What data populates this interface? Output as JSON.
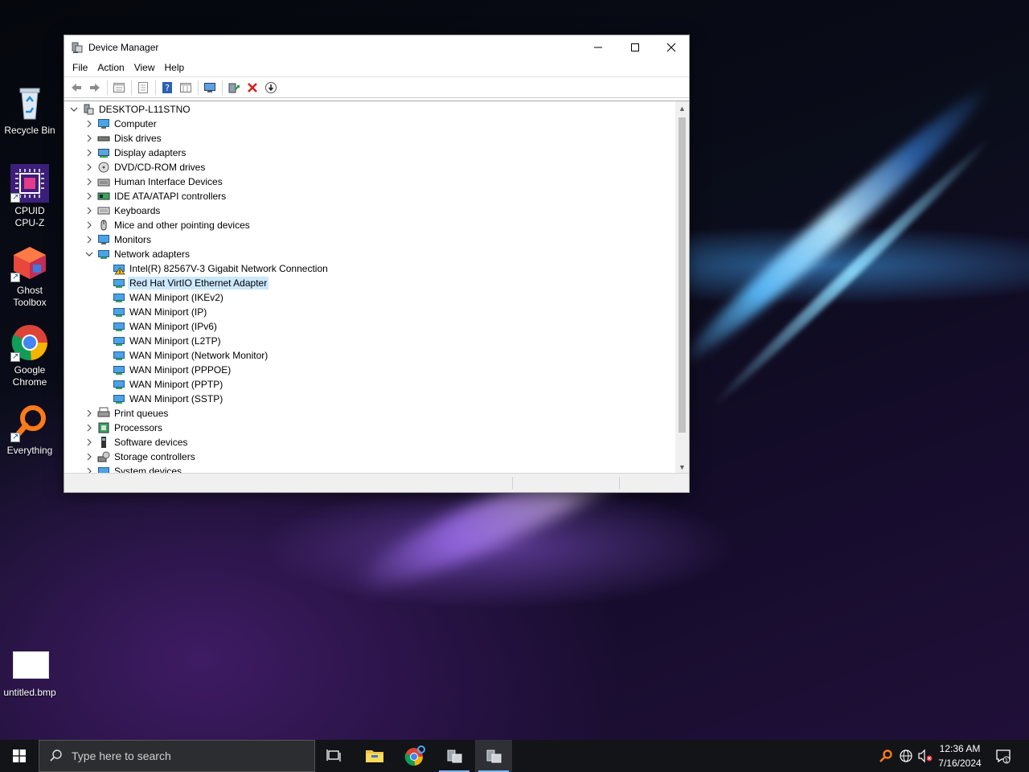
{
  "desktop": {
    "icons": [
      {
        "label": "Recycle Bin"
      },
      {
        "label": "CPUID\nCPU-Z"
      },
      {
        "label": "Ghost\nToolbox"
      },
      {
        "label": "Google\nChrome"
      },
      {
        "label": "Everything"
      },
      {
        "label": "untitled.bmp"
      }
    ]
  },
  "window": {
    "title": "Device Manager",
    "menu": [
      "File",
      "Action",
      "View",
      "Help"
    ],
    "toolbar_icons": [
      "back-arrow-icon",
      "forward-arrow-icon",
      "show-hide-tree-icon",
      "properties-icon",
      "help-icon",
      "resources-view-icon",
      "monitor-scan-icon",
      "update-driver-icon",
      "uninstall-device-icon",
      "disable-device-icon"
    ],
    "tree": {
      "root": "DESKTOP-L11STNO",
      "categories_before": [
        {
          "label": "Computer",
          "icon": "computer-icon"
        },
        {
          "label": "Disk drives",
          "icon": "disk-drive-icon"
        },
        {
          "label": "Display adapters",
          "icon": "display-adapter-icon"
        },
        {
          "label": "DVD/CD-ROM drives",
          "icon": "dvd-drive-icon"
        },
        {
          "label": "Human Interface Devices",
          "icon": "hid-icon"
        },
        {
          "label": "IDE ATA/ATAPI controllers",
          "icon": "ide-controller-icon"
        },
        {
          "label": "Keyboards",
          "icon": "keyboard-icon"
        },
        {
          "label": "Mice and other pointing devices",
          "icon": "mouse-icon"
        },
        {
          "label": "Monitors",
          "icon": "monitor-icon"
        }
      ],
      "expanded": {
        "label": "Network adapters",
        "children": [
          {
            "label": "Intel(R) 82567V-3 Gigabit Network Connection",
            "warning": true
          },
          {
            "label": "Red Hat VirtIO Ethernet Adapter",
            "selected": true
          },
          {
            "label": "WAN Miniport (IKEv2)"
          },
          {
            "label": "WAN Miniport (IP)"
          },
          {
            "label": "WAN Miniport (IPv6)"
          },
          {
            "label": "WAN Miniport (L2TP)"
          },
          {
            "label": "WAN Miniport (Network Monitor)"
          },
          {
            "label": "WAN Miniport (PPPOE)"
          },
          {
            "label": "WAN Miniport (PPTP)"
          },
          {
            "label": "WAN Miniport (SSTP)"
          }
        ]
      },
      "categories_after": [
        {
          "label": "Print queues",
          "icon": "printer-icon"
        },
        {
          "label": "Processors",
          "icon": "processor-icon"
        },
        {
          "label": "Software devices",
          "icon": "software-device-icon"
        },
        {
          "label": "Storage controllers",
          "icon": "storage-controller-icon"
        },
        {
          "label": "System devices",
          "icon": "system-device-icon"
        }
      ]
    }
  },
  "taskbar": {
    "search_placeholder": "Type here to search",
    "time": "12:36 AM",
    "date": "7/16/2024"
  },
  "colors": {
    "selection": "#cce8ff",
    "taskbar": "#121418",
    "accent": "#7ab7f5"
  }
}
